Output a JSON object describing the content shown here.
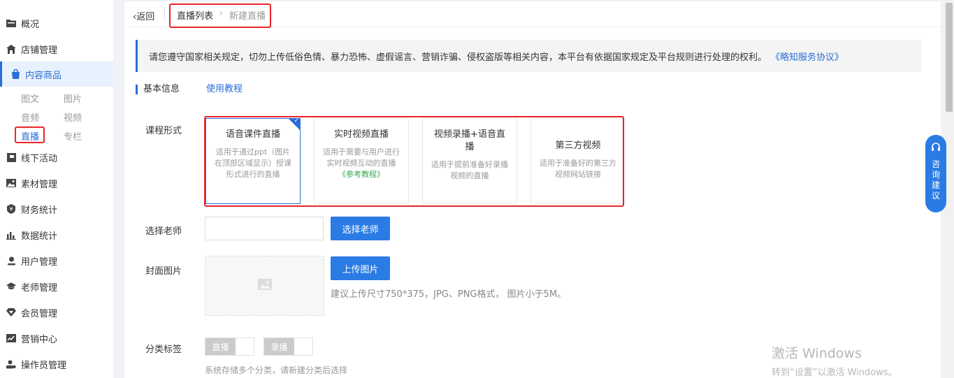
{
  "sidebar": {
    "items": [
      {
        "label": "概况",
        "icon": "folder-icon"
      },
      {
        "label": "店铺管理",
        "icon": "store-icon"
      },
      {
        "label": "内容商品",
        "icon": "bag-icon"
      },
      {
        "label": "线下活动",
        "icon": "flag-icon"
      },
      {
        "label": "素材管理",
        "icon": "image-icon"
      },
      {
        "label": "财务统计",
        "icon": "yen-icon"
      },
      {
        "label": "数据统计",
        "icon": "bar-chart-icon"
      },
      {
        "label": "用户管理",
        "icon": "user-icon"
      },
      {
        "label": "老师管理",
        "icon": "graduation-cap-icon"
      },
      {
        "label": "会员管理",
        "icon": "diamond-icon"
      },
      {
        "label": "营销中心",
        "icon": "trend-icon"
      },
      {
        "label": "操作员管理",
        "icon": "operator-icon"
      }
    ],
    "subitems": [
      "图文",
      "图片",
      "音频",
      "视频",
      "直播",
      "专栏"
    ],
    "accent_color": "#2a6ed8"
  },
  "breadcrumb": {
    "back": "返回",
    "list": "直播列表",
    "current": "新建直播"
  },
  "notice": {
    "text": "请您遵守国家相关规定，切勿上传低俗色情、暴力恐怖、虚假谣言、营销诈骗、侵权盗版等相关内容，本平台有依据国家规定及平台规则进行处理的权利。",
    "link": "《略知服务协议》"
  },
  "section": {
    "title": "基本信息",
    "tutorial": "使用教程"
  },
  "form": {
    "course_label": "课程形式",
    "course_options": [
      {
        "title": "语音课件直播",
        "desc": "适用于通过ppt（图片在顶部区域显示）授课形式进行的直播",
        "link": "",
        "selected": true
      },
      {
        "title": "实时视频直播",
        "desc": "适用于需要与用户进行实时视频互动的直播",
        "link": "《参考教程》",
        "selected": false
      },
      {
        "title": "视频录播+语音直播",
        "desc": "适用于提前准备好录播视频的直播",
        "link": "",
        "selected": false
      },
      {
        "title": "第三方视频",
        "desc": "适用于准备好的第三方视频网站链接",
        "link": "",
        "selected": false
      }
    ],
    "teacher_label": "选择老师",
    "teacher_value": "",
    "teacher_button": "选择老师",
    "cover_label": "封面图片",
    "upload_button": "上传图片",
    "upload_hint": "建议上传尺寸750*375，JPG、PNG格式， 图片小于5M。",
    "category_label": "分类标签",
    "category_toggles": [
      "直播",
      "录播"
    ],
    "category_hint": "系统存储多个分类，请新建分类后选择",
    "primary_color": "#2a7be4"
  },
  "consult": {
    "label": "咨询建议"
  },
  "watermark": {
    "line1": "激活 Windows",
    "line2": "转到“设置”以激活 Windows。"
  }
}
